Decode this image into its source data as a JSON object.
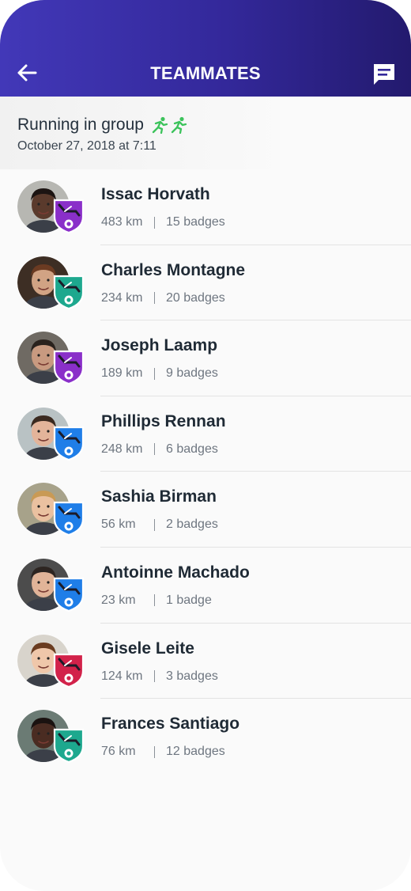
{
  "header": {
    "title": "TEAMMATES",
    "back_icon": "arrow-left-icon",
    "chat_icon": "chat-bubble-icon",
    "gradient": [
      "#4238b8",
      "#231a6e"
    ]
  },
  "group": {
    "title": "Running in group",
    "date": "October 27, 2018 at 7:11",
    "icon": "runners-icon",
    "icon_color": "#3cc35b"
  },
  "teammates": [
    {
      "name": "Issac Horvath",
      "distance": "483 km",
      "badges": "15 badges",
      "badge_color": "#8a2fc9",
      "skin": "#5a3a2c",
      "hair": "#1c1412",
      "bg": "#b7b7b2"
    },
    {
      "name": "Charles Montagne",
      "distance": "234 km",
      "badges": "20 badges",
      "badge_color": "#1da88e",
      "skin": "#d1a384",
      "hair": "#6b3b22",
      "bg": "#3d2e24"
    },
    {
      "name": "Joseph Laamp",
      "distance": "189 km",
      "badges": "9 badges",
      "badge_color": "#8a2fc9",
      "skin": "#c89a80",
      "hair": "#2a221d",
      "bg": "#6f6a63"
    },
    {
      "name": "Phillips Rennan",
      "distance": "248 km",
      "badges": "6 badges",
      "badge_color": "#1f7ee8",
      "skin": "#e3b49a",
      "hair": "#3b2a20",
      "bg": "#b9c2c4"
    },
    {
      "name": "Sashia Birman",
      "distance": "56 km",
      "badges": "2 badges",
      "badge_color": "#1f7ee8",
      "skin": "#eac1a0",
      "hair": "#c99a55",
      "bg": "#a7a28a"
    },
    {
      "name": "Antoinne Machado",
      "distance": "23 km",
      "badges": "1 badge",
      "badge_color": "#1f7ee8",
      "skin": "#e1b498",
      "hair": "#2d2521",
      "bg": "#4c4c4c"
    },
    {
      "name": "Gisele Leite",
      "distance": "124 km",
      "badges": "3 badges",
      "badge_color": "#d2224a",
      "skin": "#efc7aa",
      "hair": "#6a3c20",
      "bg": "#d8d4cc"
    },
    {
      "name": "Frances Santiago",
      "distance": "76 km",
      "badges": "12 badges",
      "badge_color": "#1da88e",
      "skin": "#4a2c22",
      "hair": "#1a1210",
      "bg": "#6b7b74"
    }
  ]
}
